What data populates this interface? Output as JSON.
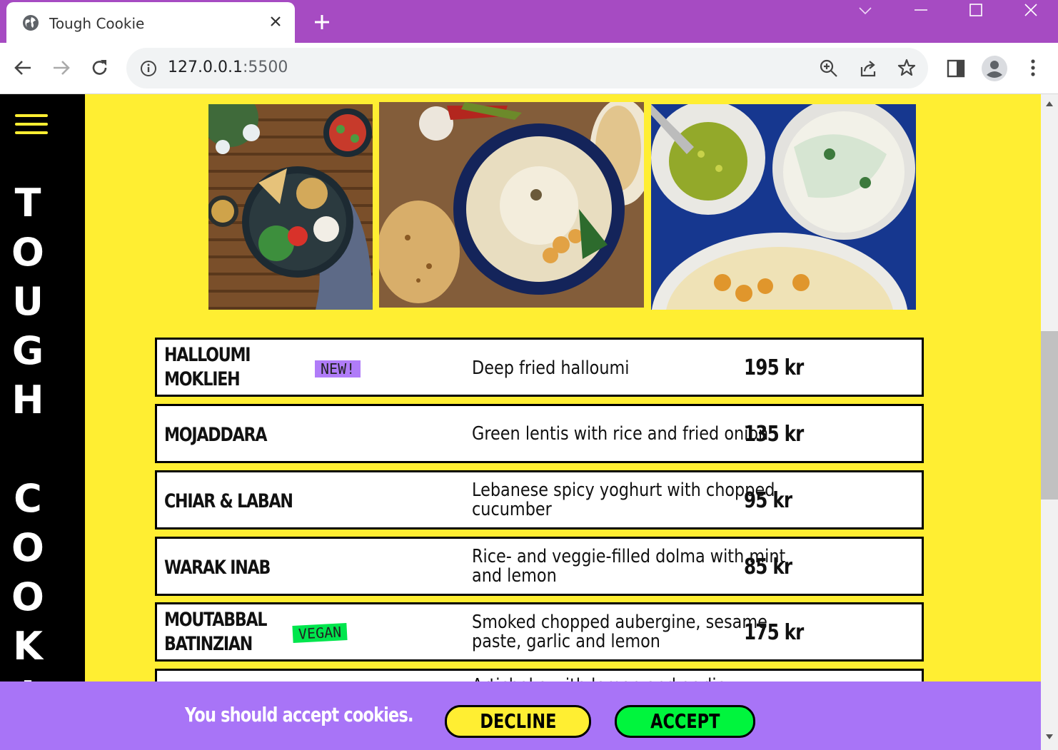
{
  "browser": {
    "tab_title": "Tough Cookie",
    "url_host": "127.0.0.1",
    "url_port": ":5500"
  },
  "site": {
    "title_letters": [
      "T",
      "O",
      "U",
      "G",
      "H",
      "",
      "C",
      "O",
      "O",
      "K",
      "I"
    ]
  },
  "menu": [
    {
      "name_line1": "HALLOUMI",
      "name_line2": "MOKLIEH",
      "tag": "NEW!",
      "desc_line1": "Deep fried halloumi",
      "desc_line2": "",
      "price": "195 kr"
    },
    {
      "name_line1": "MOJADDARA",
      "name_line2": "",
      "tag": "",
      "desc_line1": "Green lentis with rice and fried onion",
      "desc_line2": "",
      "price": "135 kr"
    },
    {
      "name_line1": "CHIAR & LABAN",
      "name_line2": "",
      "tag": "",
      "desc_line1": "Lebanese spicy yoghurt with chopped",
      "desc_line2": "cucumber",
      "price": "95 kr"
    },
    {
      "name_line1": "WARAK INAB",
      "name_line2": "",
      "tag": "",
      "desc_line1": "Rice- and veggie-filled dolma with mint",
      "desc_line2": "and lemon",
      "price": "85 kr"
    },
    {
      "name_line1": "MOUTABBAL",
      "name_line2": "BATINZIAN",
      "tag": "VEGAN",
      "desc_line1": "Smoked chopped aubergine, sesame",
      "desc_line2": "paste, garlic and lemon",
      "price": "175 kr"
    },
    {
      "name_line1": "",
      "name_line2": "",
      "tag": "",
      "desc_line1": "Artichoke with lemon and garlic",
      "desc_line2": "",
      "price": ""
    }
  ],
  "cookie_banner": {
    "message": "You should accept cookies.",
    "decline_label": "DECLINE",
    "accept_label": "ACCEPT"
  },
  "colors": {
    "page_bg": "#ffee32",
    "sidebar_bg": "#000000",
    "banner_bg": "#a874f7",
    "new_tag": "#b07cf8",
    "vegan_tag": "#00e64d",
    "accept_btn": "#00f53d",
    "decline_btn": "#ffee32"
  }
}
